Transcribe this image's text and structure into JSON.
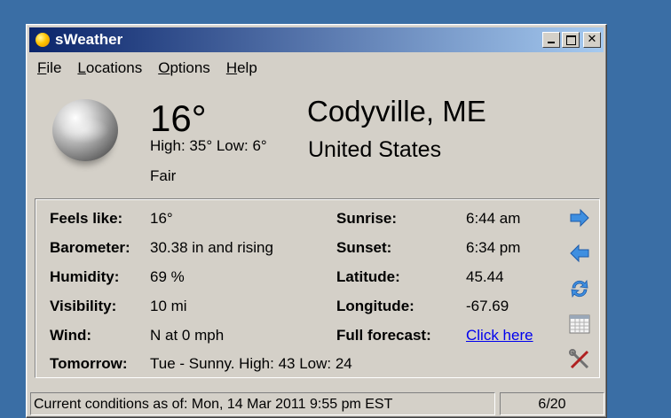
{
  "window": {
    "title": "sWeather"
  },
  "menu": [
    {
      "mn": "F",
      "rest": "ile"
    },
    {
      "mn": "L",
      "rest": "ocations"
    },
    {
      "mn": "O",
      "rest": "ptions"
    },
    {
      "mn": "H",
      "rest": "elp"
    }
  ],
  "current": {
    "temperature": "16°",
    "high_low": "High: 35° Low: 6°",
    "condition": "Fair",
    "city": "Codyville, ME",
    "country": "United States"
  },
  "details": {
    "feels_like_label": "Feels like:",
    "feels_like": "16°",
    "barometer_label": "Barometer:",
    "barometer": "30.38 in and rising",
    "humidity_label": "Humidity:",
    "humidity": "69 %",
    "visibility_label": "Visibility:",
    "visibility": "10 mi",
    "wind_label": "Wind:",
    "wind": "N at 0 mph",
    "tomorrow_label": "Tomorrow:",
    "tomorrow": "Tue - Sunny. High: 43 Low: 24",
    "sunrise_label": "Sunrise:",
    "sunrise": "6:44 am",
    "sunset_label": "Sunset:",
    "sunset": "6:34 pm",
    "latitude_label": "Latitude:",
    "latitude": "45.44",
    "longitude_label": "Longitude:",
    "longitude": "-67.69",
    "forecast_label": "Full forecast:",
    "forecast_link": "Click here"
  },
  "side_icons": [
    "arrow-right-icon",
    "arrow-left-icon",
    "refresh-icon",
    "calendar-icon",
    "tools-icon"
  ],
  "status": {
    "conditions": "Current conditions as of: Mon, 14 Mar 2011 9:55 pm EST",
    "page": "6/20"
  }
}
